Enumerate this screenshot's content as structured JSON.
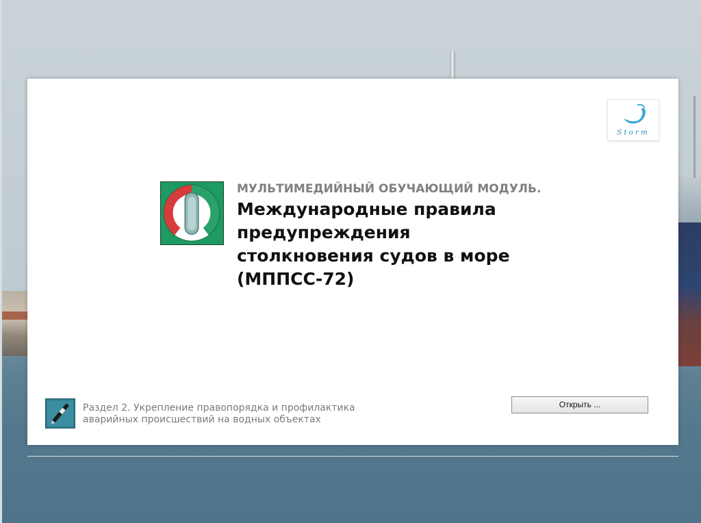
{
  "header": {
    "brand_logo": "storm-logo",
    "brand_text": "Storm"
  },
  "module": {
    "icon": "module-emblem-icon",
    "kicker": "МУЛЬТИМЕДИЙНЫЙ ОБУЧАЮЩИЙ МОДУЛЬ.",
    "title_lines": [
      "Международные правила",
      "предупреждения",
      "столкновения судов в море",
      "(МППСС-72)"
    ]
  },
  "section": {
    "icon": "pen-icon",
    "lines": [
      "Раздел 2. Укрепление правопорядка и профилактика",
      "аварийных происшествий на водных объектах"
    ]
  },
  "actions": {
    "open_label": "Открыть ..."
  },
  "colors": {
    "panel_bg": "#ffffff",
    "kicker": "#808080",
    "title": "#111111",
    "section_text": "#7a7a7a",
    "emblem_green": "#1d9b63",
    "emblem_red": "#d83b3b"
  }
}
